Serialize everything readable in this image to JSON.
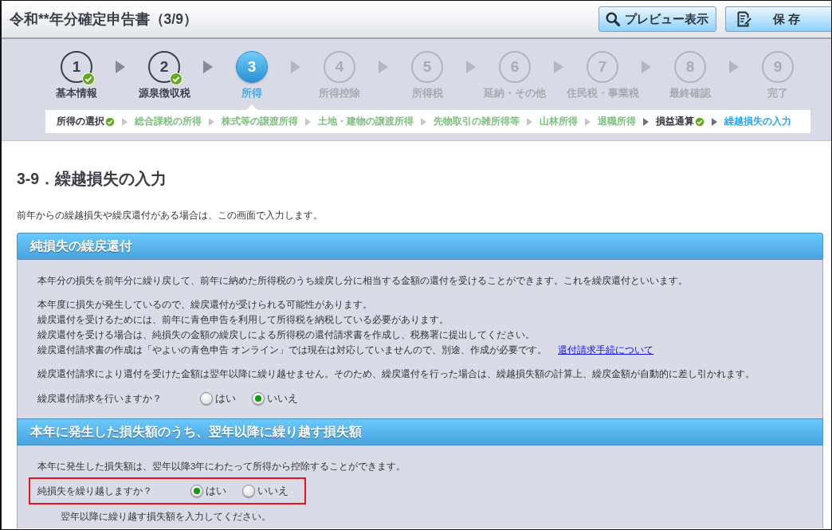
{
  "header": {
    "title": "令和**年分確定申告書（3/9）",
    "buttons": [
      {
        "kind": "preview",
        "label": "プレビュー表示"
      },
      {
        "kind": "save",
        "label": "保 存"
      }
    ]
  },
  "steps": [
    {
      "number": "1",
      "label": "基本情報",
      "done": true,
      "selected": false,
      "disabled": false
    },
    {
      "number": "2",
      "label": "源泉徴収税",
      "done": true,
      "selected": false,
      "disabled": false
    },
    {
      "number": "3",
      "label": "所得",
      "done": false,
      "selected": true,
      "disabled": false
    },
    {
      "number": "4",
      "label": "所得控除",
      "done": false,
      "selected": false,
      "disabled": true
    },
    {
      "number": "5",
      "label": "所得税",
      "done": false,
      "selected": false,
      "disabled": true
    },
    {
      "number": "6",
      "label": "延納・その他",
      "done": false,
      "selected": false,
      "disabled": true
    },
    {
      "number": "7",
      "label": "住民税・事業税",
      "done": false,
      "selected": false,
      "disabled": true
    },
    {
      "number": "8",
      "label": "最終確認",
      "done": false,
      "selected": false,
      "disabled": true
    },
    {
      "number": "9",
      "label": "完了",
      "done": false,
      "selected": false,
      "disabled": true
    }
  ],
  "substeps": [
    {
      "label": "所得の選択",
      "done": true,
      "selected": false
    },
    {
      "label": "総合課税の所得",
      "done": false,
      "selected": false
    },
    {
      "label": "株式等の譲渡所得",
      "done": false,
      "selected": false
    },
    {
      "label": "土地・建物の譲渡所得",
      "done": false,
      "selected": false
    },
    {
      "label": "先物取引の雑所得等",
      "done": false,
      "selected": false
    },
    {
      "label": "山林所得",
      "done": false,
      "selected": false
    },
    {
      "label": "退職所得",
      "done": false,
      "selected": false
    },
    {
      "label": "損益通算",
      "done": true,
      "selected": false
    },
    {
      "label": "繰越損失の入力",
      "done": false,
      "selected": true
    }
  ],
  "page": {
    "heading": "3-9．繰越損失の入力",
    "intro": "前年からの繰越損失や繰戻還付がある場合は、この画面で入力します。"
  },
  "sections": [
    {
      "title": "純損失の繰戻還付",
      "items": [
        {
          "kind": "paragraph",
          "lines": [
            {
              "text": "本年分の損失を前年分に繰り戻して、前年に納めた所得税のうち繰戻し分に相当する金額の還付を受けることができます。これを繰戻還付といいます。"
            }
          ]
        },
        {
          "kind": "paragraph",
          "lines": [
            {
              "text": "本年度に損失が発生しているので、繰戻還付が受けられる可能性があります。"
            },
            {
              "text": "繰戻還付を受けるためには、前年に青色申告を利用して所得税を納税している必要があります。"
            },
            {
              "text": "繰戻還付を受ける場合は、純損失の金額の繰戻しによる所得税の還付請求書を作成し、税務署に提出してください。"
            },
            {
              "text": "繰戻還付請求書の作成は「やよいの青色申告 オンライン」では現在は対応していませんので、別途、作成が必要です。",
              "link": "還付請求手続について"
            }
          ]
        },
        {
          "kind": "paragraph",
          "lines": [
            {
              "text": "繰戻還付請求により還付を受けた金額は翌年以降に繰り越せません。そのため、繰戻還付を行った場合は、繰越損失額の計算上、繰戻金額が自動的に差し引かれます。"
            }
          ]
        },
        {
          "kind": "question",
          "label": "繰戻還付請求を行いますか？",
          "highlighted": false,
          "options": [
            {
              "label": "はい",
              "selected": false
            },
            {
              "label": "いいえ",
              "selected": true
            }
          ]
        }
      ]
    },
    {
      "title": "本年に発生した損失額のうち、翌年以降に繰り越す損失額",
      "items": [
        {
          "kind": "paragraph",
          "lines": [
            {
              "text": "本年に発生した損失額は、翌年以降3年にわたって所得から控除することができます。"
            }
          ]
        },
        {
          "kind": "question",
          "label": "純損失を繰り越しますか？",
          "highlighted": true,
          "options": [
            {
              "label": "はい",
              "selected": true
            },
            {
              "label": "いいえ",
              "selected": false
            }
          ]
        },
        {
          "kind": "note",
          "text": "翌年以降に繰り越す損失額を入力してください。"
        }
      ]
    }
  ]
}
